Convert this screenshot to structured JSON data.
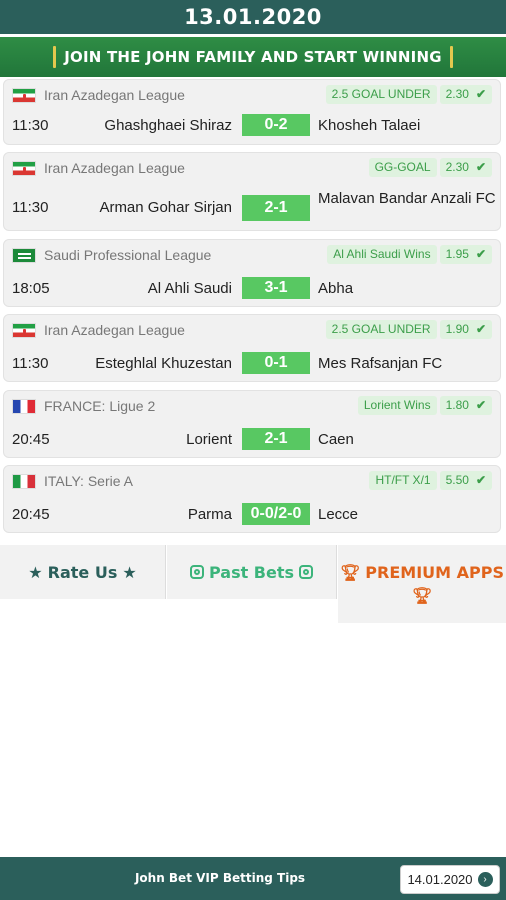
{
  "header": {
    "date": "13.01.2020"
  },
  "banner": {
    "text": "JOIN THE JOHN FAMILY AND START WINNING"
  },
  "matches": [
    {
      "flag": "iran",
      "league": "Iran Azadegan League",
      "tip": "2.5 GOAL UNDER",
      "odds": "2.30",
      "time": "11:30",
      "home": "Ghashghaei Shiraz",
      "score": "0-2",
      "away": "Khosheh Talaei"
    },
    {
      "flag": "iran",
      "league": "Iran Azadegan League",
      "tip": "GG-GOAL",
      "odds": "2.30",
      "time": "11:30",
      "home": "Arman Gohar Sirjan",
      "score": "2-1",
      "away": "Malavan Bandar Anzali FC"
    },
    {
      "flag": "saudi",
      "league": "Saudi Professional League",
      "tip": "Al Ahli Saudi Wins",
      "odds": "1.95",
      "time": "18:05",
      "home": "Al Ahli Saudi",
      "score": "3-1",
      "away": "Abha"
    },
    {
      "flag": "iran",
      "league": "Iran Azadegan League",
      "tip": "2.5 GOAL UNDER",
      "odds": "1.90",
      "time": "11:30",
      "home": "Esteghlal Khuzestan",
      "score": "0-1",
      "away": "Mes Rafsanjan FC"
    },
    {
      "flag": "france",
      "league": "FRANCE: Ligue 2",
      "tip": "Lorient Wins",
      "odds": "1.80",
      "time": "20:45",
      "home": "Lorient",
      "score": "2-1",
      "away": "Caen"
    },
    {
      "flag": "italy",
      "league": "ITALY: Serie A",
      "tip": "HT/FT X/1",
      "odds": "5.50",
      "time": "20:45",
      "home": "Parma",
      "score": "0-0/2-0",
      "away": "Lecce"
    }
  ],
  "menu": {
    "rate": "Rate Us",
    "past": "Past Bets",
    "premium": "PREMIUM APPS"
  },
  "footer": {
    "title": "John Bet VIP Betting Tips",
    "next_date": "14.01.2020"
  },
  "colors": {
    "header": "#2b5f5b",
    "banner": "#21763a",
    "score": "#58c862",
    "premium": "#e0641c"
  }
}
